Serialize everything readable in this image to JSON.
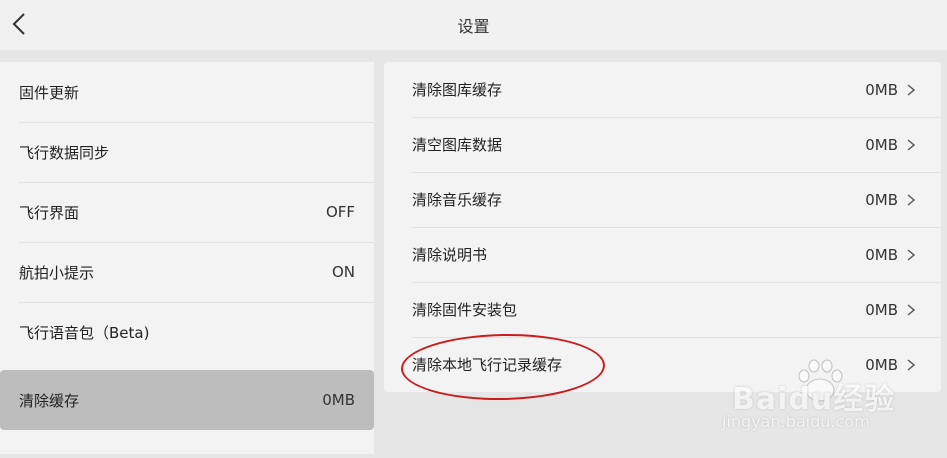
{
  "header": {
    "title": "设置",
    "back_icon": "chevron-left-icon"
  },
  "left_menu": [
    {
      "label": "固件更新",
      "value": ""
    },
    {
      "label": "飞行数据同步",
      "value": ""
    },
    {
      "label": "飞行界面",
      "value": "OFF"
    },
    {
      "label": "航拍小提示",
      "value": "ON"
    },
    {
      "label": "飞行语音包（Beta)",
      "value": ""
    },
    {
      "label": "清除缓存",
      "value": "0MB",
      "selected": true
    }
  ],
  "cache_list": [
    {
      "label": "清除图库缓存",
      "value": "0MB"
    },
    {
      "label": "清空图库数据",
      "value": "0MB"
    },
    {
      "label": "清除音乐缓存",
      "value": "0MB"
    },
    {
      "label": "清除说明书",
      "value": "0MB"
    },
    {
      "label": "清除固件安装包",
      "value": "0MB"
    },
    {
      "label": "清除本地飞行记录缓存",
      "value": "0MB"
    }
  ],
  "watermark": {
    "text": "Baidu经验",
    "url_text": "jingyan.baidu.com"
  },
  "colors": {
    "annotation": "#c81e1e",
    "selected_row": "#bdbdbd",
    "background": "#e6e6e6"
  }
}
